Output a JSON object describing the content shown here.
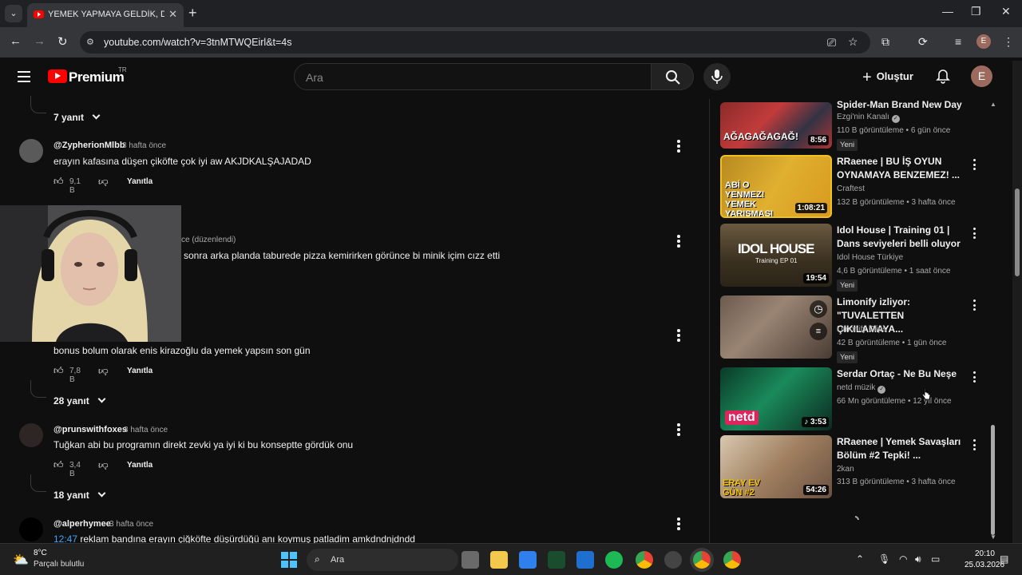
{
  "browser": {
    "tab_title": "YEMEK YAPMAYA GELDİK, DAYA",
    "url": "youtube.com/watch?v=3tnMTWQEirl&t=4s",
    "profile_initial": "E"
  },
  "masthead": {
    "logo_text": "Premium",
    "region": "TR",
    "search_placeholder": "Ara",
    "create_label": "Oluştur",
    "avatar_initial": "E"
  },
  "comments": {
    "reply_label": "Yanıtla",
    "items": [
      {
        "replies": "7 yanıt"
      },
      {
        "author": "@ZypherionMlbb",
        "time": "3 hafta önce",
        "text": "erayın kafasına düşen çiköfte çok iyi aw AKJDKALŞAJADAD",
        "likes": "9,1 B"
      },
      {
        "time_partial": "ce (düzenlendi)",
        "text_partial": "sonra arka planda taburede pizza kemirirken görünce bi minik içim cızz etti"
      },
      {
        "text": "bonus bolum olarak enis kirazoğlu da yemek yapsın son gün",
        "likes": "7,8 B",
        "replies": "28 yanıt"
      },
      {
        "author": "@prunswithfoxes",
        "time": "3 hafta önce",
        "text": "Tuğkan abi bu programın direkt zevki ya iyi ki bu konseptte gördük onu",
        "likes": "3,4 B",
        "replies": "18 yanıt"
      },
      {
        "author": "@alperhymee",
        "time": "3 hafta önce",
        "timestamp_link": "12:47",
        "text": " reklam bandına erayın çiğköfte düşürdüğü anı koymuş patladim amkdndnjdndd"
      }
    ]
  },
  "related": [
    {
      "title": "Spider-Man Brand New Day ...",
      "channel": "Ezgi'nin Kanalı",
      "verified": true,
      "meta": "110 B görüntüleme • 6 gün önce",
      "badge": "Yeni",
      "duration": "8:56",
      "thumb_text": "AĞAGAĞAGAĞ!"
    },
    {
      "title": "RRaenee | BU İŞ OYUN OYNAMAYA BENZEMEZ! ...",
      "channel": "Craftest",
      "verified": false,
      "meta": "132 B görüntüleme • 3 hafta önce",
      "duration": "1:08:21",
      "thumb_text": "ABİ O YENMEZ! YEMEK YARIŞMASI"
    },
    {
      "title": "Idol House | Training 01 | Dans seviyeleri belli oluyor",
      "channel": "Idol House Türkiye",
      "verified": false,
      "meta": "4,6 B görüntüleme • 1 saat önce",
      "badge": "Yeni",
      "duration": "19:54",
      "thumb_text": "IDOL HOUSE",
      "thumb_sub": "Training EP 01"
    },
    {
      "title": "Limonify izliyor: \"TUVALETTEN ÇIKILAMAYA...",
      "channel": "Limonify Clips",
      "verified": false,
      "meta": "42 B görüntüleme • 1 gün önce",
      "badge": "Yeni"
    },
    {
      "title": "Serdar Ortaç - Ne Bu Neşe",
      "channel": "netd müzik",
      "verified": true,
      "meta": "66 Mn görüntüleme • 12 yıl önce",
      "duration": "3:53",
      "thumb_text": "netd"
    },
    {
      "title": "RRaenee | Yemek Savaşları Bölüm #2 Tepki! ...",
      "channel": "2kan",
      "verified": false,
      "meta": "313 B görüntüleme • 3 hafta önce",
      "duration": "54:26",
      "thumb_text": "ERAY EV GÜN #2"
    }
  ],
  "taskbar": {
    "temperature": "8°C",
    "weather": "Parçalı bulutlu",
    "search_placeholder": "Ara",
    "time": "20:10",
    "date": "25.03.2026"
  }
}
